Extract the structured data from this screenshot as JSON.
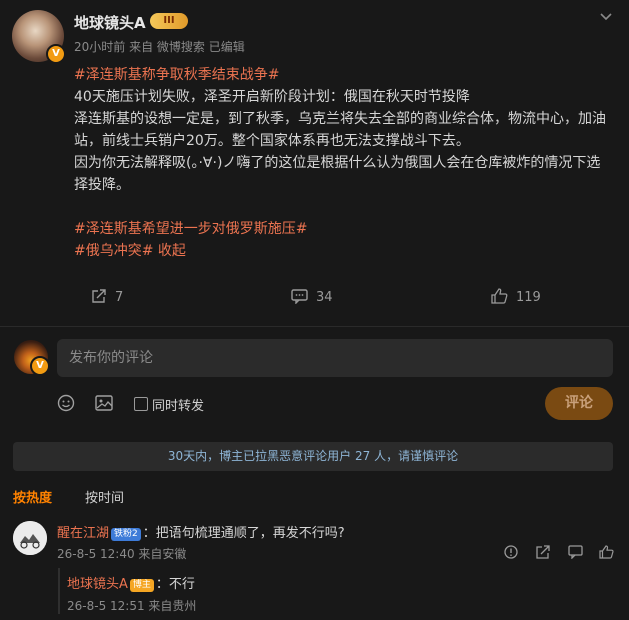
{
  "post": {
    "username": "地球镜头A",
    "vip_badge": "III",
    "meta": "20小时前  来自 微博搜索  已编辑",
    "tag1": "#泽连斯基称争取秋季结束战争#",
    "line1": "40天施压计划失败，泽圣开启新阶段计划：俄国在秋天时节投降",
    "line2": "泽连斯基的设想一定是，到了秋季，乌克兰将失去全部的商业综合体，物流中心，加油站，前线士兵销户20万。整个国家体系再也无法支撑战斗下去。",
    "line3": "因为你无法解释吸(。·∀·)ノ嗨了的这位是根据什么认为俄国人会在仓库被炸的情况下选择投降。",
    "tag2": "#泽连斯基希望进一步对俄罗斯施压#",
    "tag3": "#俄乌冲突#",
    "collapse": "收起",
    "reposts": "7",
    "comments": "34",
    "likes": "119"
  },
  "composer": {
    "placeholder": "发布你的评论",
    "repost_label": "同时转发",
    "submit_label": "评论"
  },
  "notice": "30天内，博主已拉黑恶意评论用户 27 人，请谨慎评论",
  "sort": {
    "hot": "按热度",
    "time": "按时间"
  },
  "comment": {
    "name": "醒在江湖",
    "level": "铁粉2",
    "text": "：把语句梳理通顺了，再发不行吗?",
    "meta": "26-8-5 12:40 来自安徽"
  },
  "reply": {
    "name": "地球镜头A",
    "badge": "博主",
    "text": "：不行",
    "meta": "26-8-5 12:51 来自贵州"
  }
}
